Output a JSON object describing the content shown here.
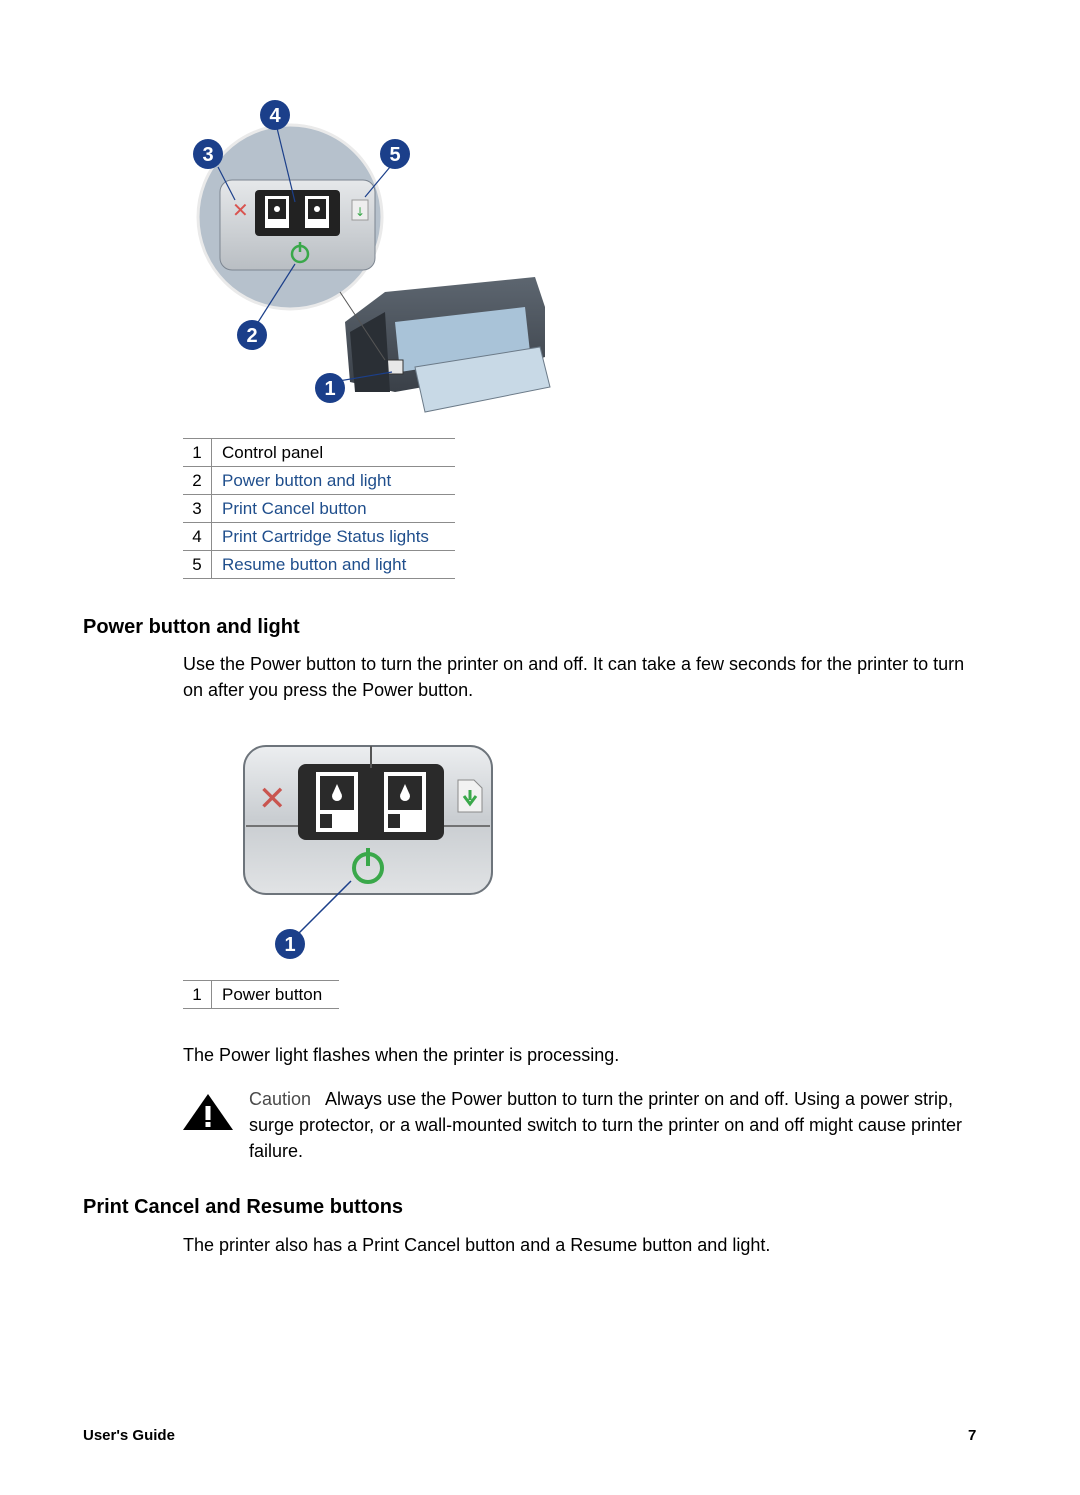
{
  "figure1": {
    "callouts": [
      "1",
      "2",
      "3",
      "4",
      "5"
    ]
  },
  "legend1": [
    {
      "num": "1",
      "label": "Control panel",
      "link": false
    },
    {
      "num": "2",
      "label": "Power button and light",
      "link": true
    },
    {
      "num": "3",
      "label": "Print Cancel button",
      "link": true
    },
    {
      "num": "4",
      "label": "Print Cartridge Status lights",
      "link": true
    },
    {
      "num": "5",
      "label": "Resume button and light",
      "link": true
    }
  ],
  "section_power": {
    "heading": "Power button and light",
    "body": "Use the Power button to turn the printer on and off. It can take a few seconds for the printer to turn on after you press the Power button."
  },
  "figure2": {
    "callouts": [
      "1"
    ]
  },
  "legend2": [
    {
      "num": "1",
      "label": "Power button"
    }
  ],
  "flash_text": "The Power light flashes when the printer is processing.",
  "caution": {
    "label": "Caution",
    "text": "Always use the Power button to turn the printer on and off. Using a power strip, surge protector, or a wall-mounted switch to turn the printer on and off might cause printer failure."
  },
  "section_cancel": {
    "heading": "Print Cancel and Resume buttons",
    "body": "The printer also has a Print Cancel button and a Resume button and light."
  },
  "footer": {
    "left": "User's Guide",
    "page": "7"
  },
  "colors": {
    "link": "#1f4e8c",
    "callout": "#1b3f8a",
    "power_green": "#3aa84a",
    "cancel_red": "#d9534f"
  }
}
